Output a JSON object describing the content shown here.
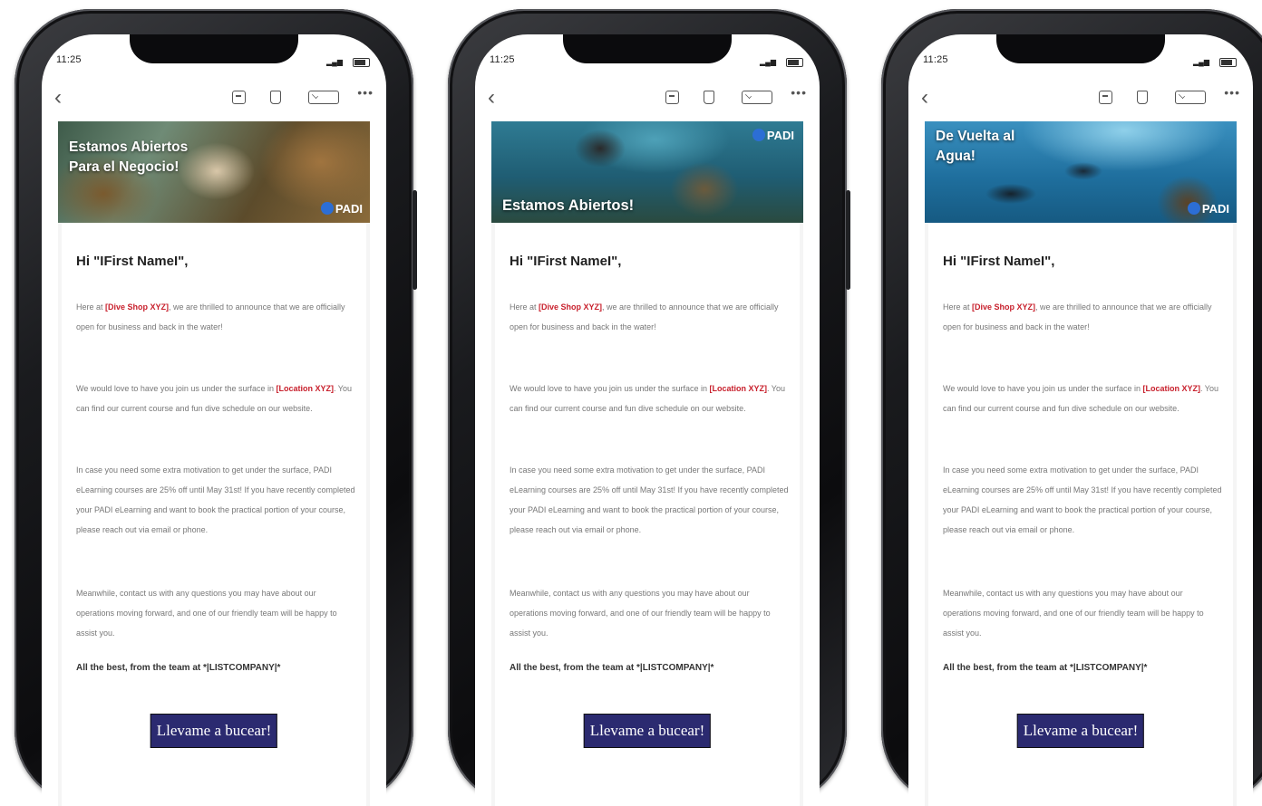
{
  "status_bar": {
    "time": "11:25"
  },
  "colors": {
    "cta_bg": "#2b2a70",
    "highlight": "#c8202c",
    "brand_blue": "#2c6ed5"
  },
  "phones": [
    {
      "banner_text": "Estamos Abiertos Para el Negocio!",
      "greeting": "Hi \"IFirst NameI\",",
      "p1_a": "Here at ",
      "p1_highlight": "[Dive Shop XYZ]",
      "p1_b": ", we are thrilled to announce that we are officially open for business and back in the water!",
      "p2_a": "We would love to have you join us under the surface in ",
      "p2_highlight": "[Location XYZ]",
      "p2_b": ". You can find our current course and fun dive schedule on our website.",
      "p3": "In case you need some extra motivation to get under the surface, PADI eLearning courses are 25% off until May 31st! If you have recently completed your PADI eLearning and want to book the practical portion of your course, please reach out via email or phone.",
      "p4": "Meanwhile, contact us with any questions you may have about our operations moving forward, and one of our friendly team will be happy to assist you.",
      "signature": "All the best, from the team at *|LISTCOMPANY|*",
      "logo": "PADI",
      "cta": "Llevame a bucear!"
    },
    {
      "banner_text": "Estamos Abiertos!",
      "greeting": "Hi \"IFirst NameI\",",
      "p1_a": "Here at ",
      "p1_highlight": "[Dive Shop XYZ]",
      "p1_b": ", we are thrilled to announce that we are officially open for business and back in the water!",
      "p2_a": "We would love to have you join us under the surface in ",
      "p2_highlight": "[Location XYZ]",
      "p2_b": ". You can find our current course and fun dive schedule on our website.",
      "p3": "In case you need some extra motivation to get under the surface, PADI eLearning courses are 25% off until May 31st! If you have recently completed your PADI eLearning and want to book the practical portion of your course, please reach out via email or phone.",
      "p4": "Meanwhile, contact us with any questions you may have about our operations moving forward, and one of our friendly team will be happy to assist you.",
      "signature": "All the best, from the team at *|LISTCOMPANY|*",
      "logo": "PADI",
      "cta": "Llevame a bucear!"
    },
    {
      "banner_text": "De Vuelta al Agua!",
      "greeting": "Hi \"IFirst NameI\",",
      "p1_a": "Here at ",
      "p1_highlight": "[Dive Shop XYZ]",
      "p1_b": ", we are thrilled to announce that we are officially open for business and back in the water!",
      "p2_a": "We would love to have you join us under the surface in ",
      "p2_highlight": "[Location XYZ]",
      "p2_b": ". You can find our current course and fun dive schedule on our website.",
      "p3": "In case you need some extra motivation to get under the surface, PADI eLearning courses are 25% off until May 31st! If you have recently completed your PADI eLearning and want to book the practical portion of your course, please reach out via email or phone.",
      "p4": "Meanwhile, contact us with any questions you may have about our operations moving forward, and one of our friendly team will be happy to assist you.",
      "signature": "All the best, from the team at *|LISTCOMPANY|*",
      "logo": "PADI",
      "cta": "Llevame a bucear!"
    }
  ]
}
